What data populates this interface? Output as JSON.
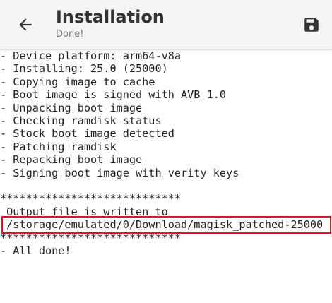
{
  "app_bar": {
    "title": "Installation",
    "subtitle": "Done!",
    "back_icon": "arrow-back-icon",
    "save_icon": "save-icon"
  },
  "console": {
    "lines": [
      "- Device platform: arm64-v8a",
      "- Installing: 25.0 (25000)",
      "- Copying image to cache",
      "- Boot image is signed with AVB 1.0",
      "- Unpacking boot image",
      "- Checking ramdisk status",
      "- Stock boot image detected",
      "- Patching ramdisk",
      "- Repacking boot image",
      "- Signing boot image with verity keys",
      "",
      "****************************",
      " Output file is written to",
      " /storage/emulated/0/Download/magisk_patched-25000",
      "****************************",
      "- All done!"
    ]
  },
  "colors": {
    "app_bar_bg": "#f5f5f5",
    "title_text": "#333333",
    "subtitle_text": "#777777",
    "console_text": "#222222",
    "highlight": "#e8121f"
  }
}
